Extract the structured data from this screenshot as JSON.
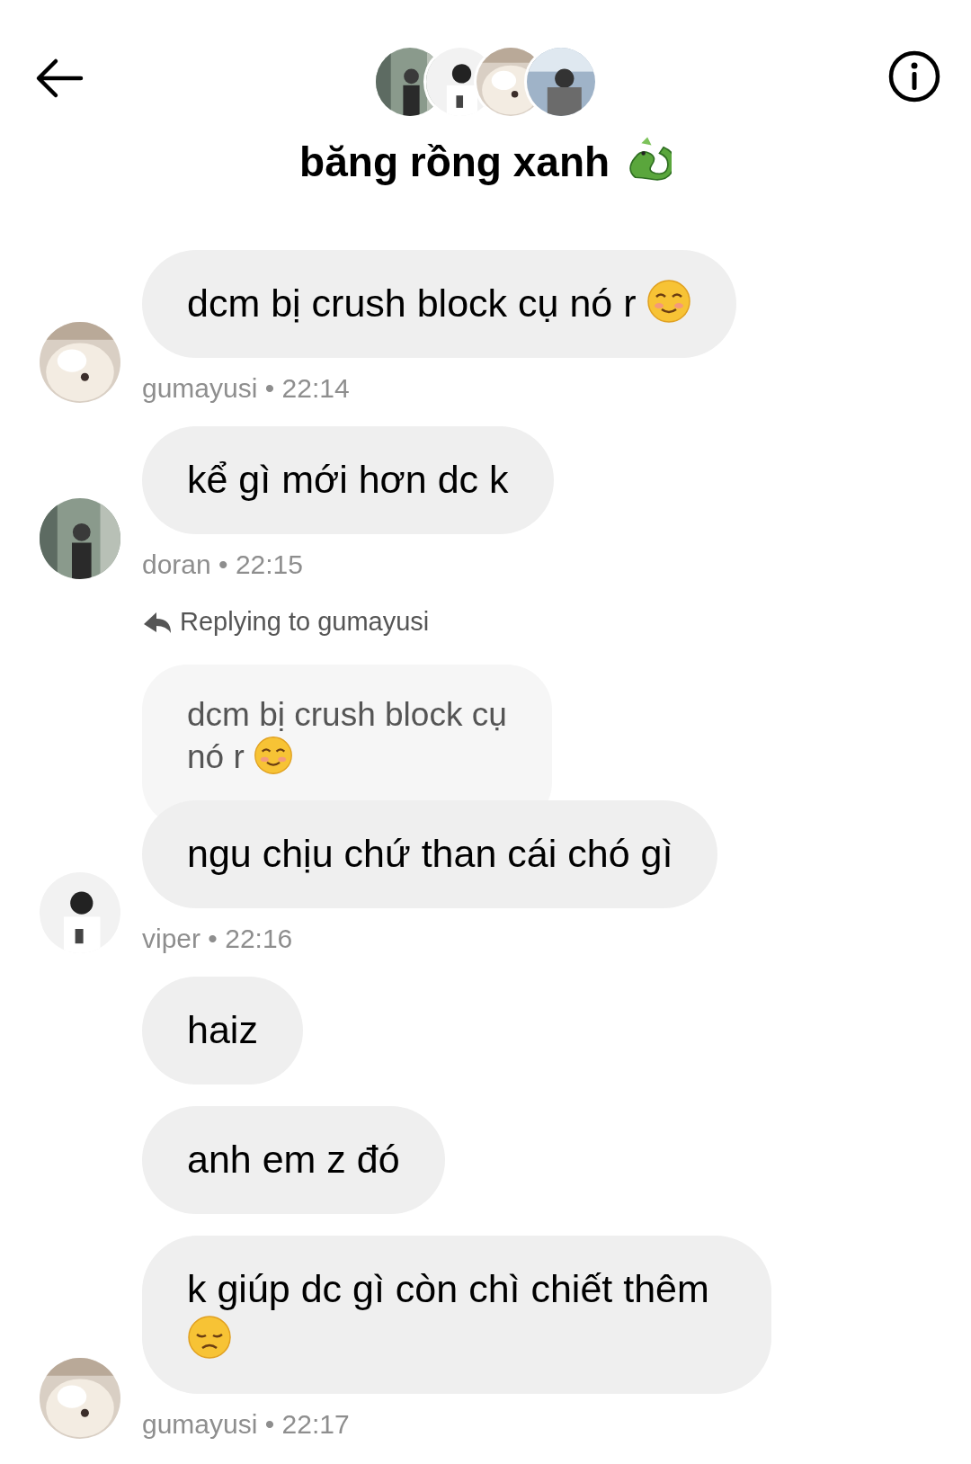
{
  "header": {
    "title": {
      "text": "băng rồng xanh",
      "kind": "dragon"
    },
    "avatars": [
      {
        "kind": "picture"
      },
      {
        "kind": "picture"
      },
      {
        "kind": "picture"
      },
      {
        "kind": "picture"
      }
    ]
  },
  "items": [
    {
      "kind": "group",
      "meta": "gumayusi • 22:14",
      "avatar": {
        "kind": "picture"
      },
      "bubbles": [
        {
          "text": "dcm bị crush block cụ nó r",
          "kind": "smiling"
        }
      ]
    },
    {
      "kind": "group",
      "meta": "doran • 22:15",
      "avatar": {
        "kind": "picture"
      },
      "bubbles": [
        {
          "text": "kể gì mới hơn dc k",
          "kind": "plain"
        }
      ]
    },
    {
      "kind": "group",
      "meta": "viper • 22:16",
      "avatar": {
        "kind": "picture"
      },
      "reply": {
        "label": "Replying to gumayusi",
        "quote": {
          "lines": [
            "dcm bị crush block cụ",
            "nó r"
          ],
          "kind": "smiling"
        }
      },
      "bubbles": [
        {
          "text": "ngu chịu chứ than cái chó gì",
          "kind": "plain"
        }
      ]
    },
    {
      "kind": "group",
      "meta": "gumayusi • 22:17",
      "avatar": {
        "kind": "picture"
      },
      "bubbles": [
        {
          "text": "haiz",
          "kind": "plain"
        },
        {
          "text": "anh em z đó",
          "kind": "plain"
        },
        {
          "text": "k giúp dc gì còn chì chiết thêm",
          "kind": "sad"
        }
      ]
    }
  ]
}
